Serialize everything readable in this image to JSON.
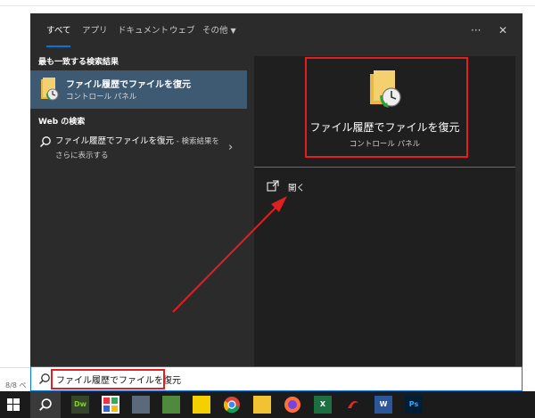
{
  "tabs": [
    {
      "label": "すべて",
      "active": true
    },
    {
      "label": "アプリ"
    },
    {
      "label": "ドキュメント"
    },
    {
      "label": "ウェブ"
    },
    {
      "label": "その他"
    }
  ],
  "header": {
    "more_label": "···",
    "close_label": "✕"
  },
  "best_match": {
    "section_label": "最も一致する検索結果",
    "title": "ファイル履歴でファイルを復元",
    "subtitle": "コントロール パネル"
  },
  "web": {
    "section_label": "Web の検索",
    "query": "ファイル履歴でファイルを復元",
    "suffix": " - 検索結果を",
    "suffix2": "さらに表示する"
  },
  "preview": {
    "title": "ファイル履歴でファイルを復元",
    "subtitle": "コントロール パネル",
    "action_open": "開く"
  },
  "searchbar": {
    "value": "ファイル履歴でファイルを復元"
  },
  "document": {
    "page_status": "8/8 ペ"
  },
  "taskbar": {
    "apps": [
      {
        "name": "dreamweaver",
        "label": "Dw",
        "bg": "#35452a",
        "fg": "#7ed321"
      },
      {
        "name": "app-grid",
        "label": "",
        "bg": "#ffffff",
        "fg": "#000"
      },
      {
        "name": "calculator",
        "label": "",
        "bg": "#5a6a7a",
        "fg": "#fff"
      },
      {
        "name": "photos",
        "label": "",
        "bg": "#4f8a3c",
        "fg": "#fff"
      },
      {
        "name": "sticky-notes",
        "label": "",
        "bg": "#f5d000",
        "fg": "#000"
      },
      {
        "name": "chrome",
        "label": "",
        "bg": "#1b1b1b",
        "fg": "#fff"
      },
      {
        "name": "file-explorer",
        "label": "",
        "bg": "#f1c232",
        "fg": "#000"
      },
      {
        "name": "firefox",
        "label": "",
        "bg": "#1b1b1b",
        "fg": "#fff"
      },
      {
        "name": "excel",
        "label": "X",
        "bg": "#1d6f42",
        "fg": "#fff"
      },
      {
        "name": "red-app",
        "label": "",
        "bg": "#1b1b1b",
        "fg": "#fff"
      },
      {
        "name": "word",
        "label": "W",
        "bg": "#2b579a",
        "fg": "#fff"
      },
      {
        "name": "photoshop",
        "label": "Ps",
        "bg": "#001e36",
        "fg": "#31a8ff"
      }
    ]
  },
  "colors": {
    "accent": "#0078d7",
    "highlight": "#3e5a72",
    "annotation": "#e02020"
  }
}
